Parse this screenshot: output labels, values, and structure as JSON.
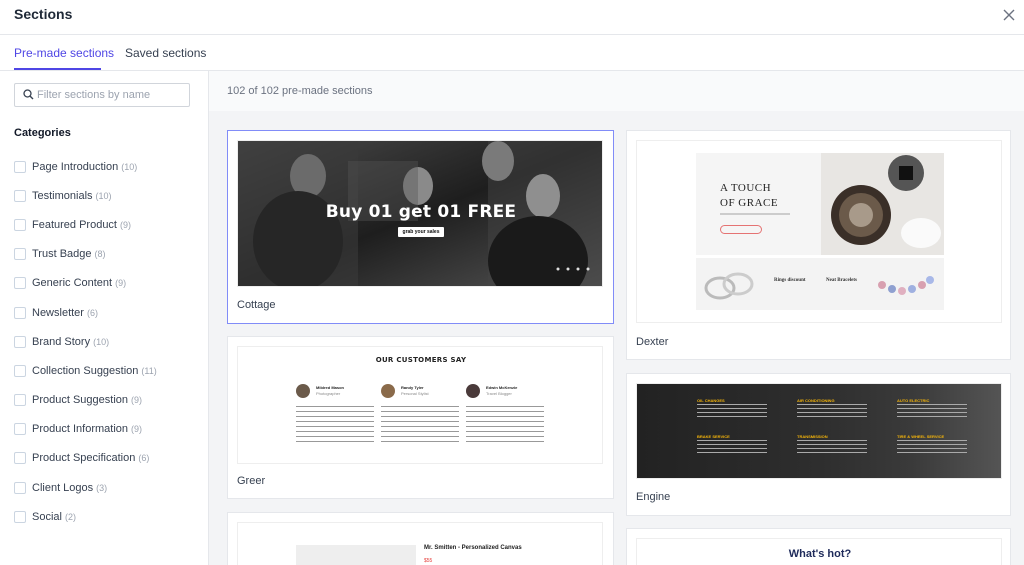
{
  "header": {
    "title": "Sections"
  },
  "tabs": [
    {
      "label": "Pre-made sections",
      "active": true
    },
    {
      "label": "Saved sections",
      "active": false
    }
  ],
  "sidebar": {
    "search_placeholder": "Filter sections by name",
    "categories_heading": "Categories",
    "categories": [
      {
        "label": "Page Introduction",
        "count": "(10)"
      },
      {
        "label": "Testimonials",
        "count": "(10)"
      },
      {
        "label": "Featured Product",
        "count": "(9)"
      },
      {
        "label": "Trust Badge",
        "count": "(8)"
      },
      {
        "label": "Generic Content",
        "count": "(9)"
      },
      {
        "label": "Newsletter",
        "count": "(6)"
      },
      {
        "label": "Brand Story",
        "count": "(10)"
      },
      {
        "label": "Collection Suggestion",
        "count": "(11)"
      },
      {
        "label": "Product Suggestion",
        "count": "(9)"
      },
      {
        "label": "Product Information",
        "count": "(9)"
      },
      {
        "label": "Product Specification",
        "count": "(6)"
      },
      {
        "label": "Client Logos",
        "count": "(3)"
      },
      {
        "label": "Social",
        "count": "(2)"
      }
    ]
  },
  "main": {
    "count_text": "102 of 102 pre-made sections",
    "cards": [
      {
        "label": "Cottage",
        "promo_title": "Buy 01 get 01 FREE",
        "promo_sub": "grab your sales"
      },
      {
        "label": "Dexter",
        "heading_line1": "A TOUCH",
        "heading_line2": "OF GRACE",
        "tile1": "Rings discount",
        "tile2": "Neat Bracelets"
      },
      {
        "label": "Greer",
        "heading": "OUR CUSTOMERS SAY",
        "people": [
          {
            "name": "Mildred Mason",
            "role": "Photographer"
          },
          {
            "name": "Randy Tyler",
            "role": "Personal Stylist"
          },
          {
            "name": "Edwin McKenzie",
            "role": "Travel Blogger"
          }
        ]
      },
      {
        "label": "Engine",
        "services": [
          "OIL CHANGES",
          "AIR CONDITIONING",
          "AUTO ELECTRIC",
          "BRAKE SERVICE",
          "TRANSMISSION",
          "TIRE & WHEEL SERVICE"
        ]
      },
      {
        "label": "",
        "product_title": "Mr. Smitten - Personalized Canvas",
        "price": "$55"
      },
      {
        "label": "",
        "heading": "What's hot?"
      }
    ]
  },
  "colors": {
    "accent": "#4f46e5",
    "engine_gold": "#f5b50a"
  }
}
